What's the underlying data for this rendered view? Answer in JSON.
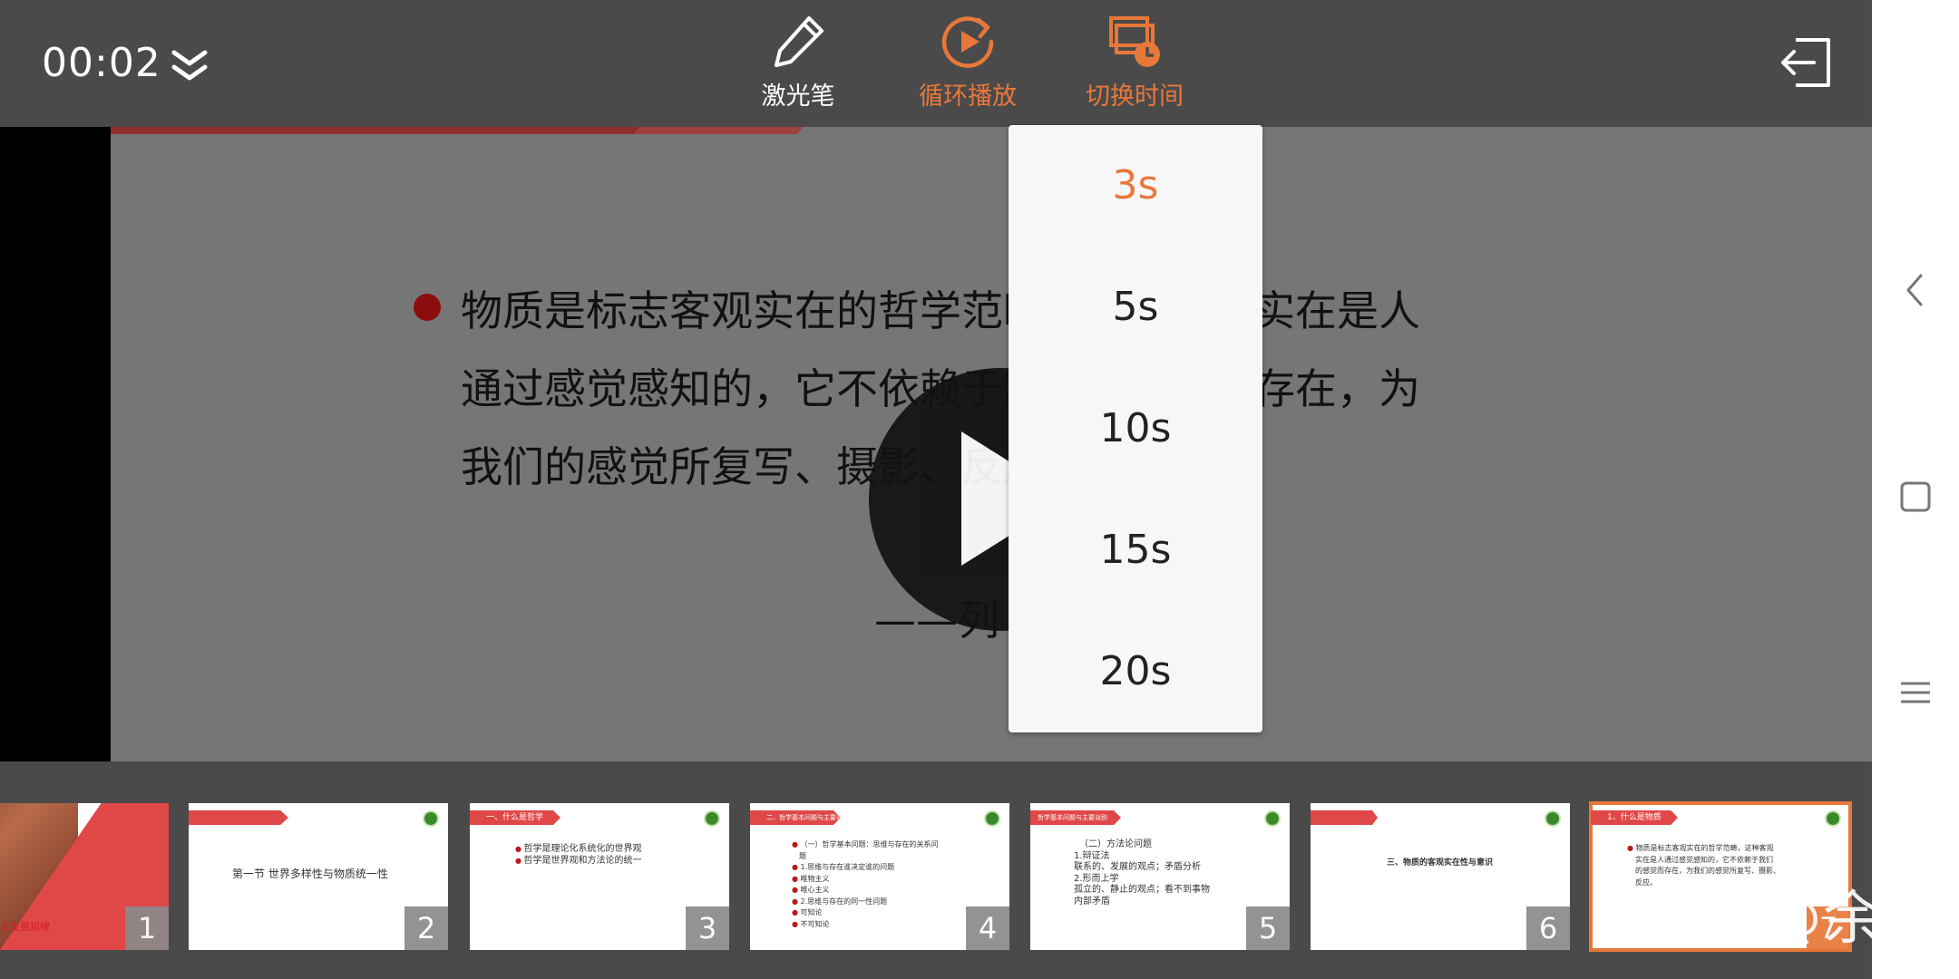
{
  "topbar": {
    "timer": "00:02",
    "tools": [
      {
        "label": "激光笔",
        "icon": "pen-icon",
        "color": "#ffffff"
      },
      {
        "label": "循环播放",
        "icon": "loop-play-icon",
        "color": "#e8783a"
      },
      {
        "label": "切换时间",
        "icon": "switch-time-icon",
        "color": "#e8783a"
      }
    ]
  },
  "slide": {
    "text": "物质是标志客观实在的哲学范畴，这种客观实在是人通过感觉感知的，它不依赖于我们的感觉而存在，为我们的感觉所复写、摄影、反应。",
    "attribution": "——列"
  },
  "dropdown": {
    "options": [
      "3s",
      "5s",
      "10s",
      "15s",
      "20s"
    ],
    "selected": "3s"
  },
  "thumbnails": [
    {
      "num": "1",
      "caption": "及发展规律"
    },
    {
      "num": "2",
      "caption": "第一节 世界多样性与物质统一性"
    },
    {
      "num": "3",
      "ribbon": "一、什么是哲学",
      "lines": [
        "哲学是理论化系统化的世界观",
        "哲学是世界观和方法论的统一"
      ]
    },
    {
      "num": "4",
      "ribbon": "二、哲学基本问题与主要派别",
      "lines": [
        "（一）哲学基本问题：思维与存在的关系问",
        "题",
        "1.思维与存在谁决定谁的问题",
        "唯物主义",
        "唯心主义",
        "2.思维与存在的同一性问题",
        "可知论",
        "不可知论"
      ]
    },
    {
      "num": "5",
      "ribbon": "哲学基本问题与主要派别",
      "lines": [
        "（二）方法论问题",
        "1.辩证法",
        "联系的、发展的观点；矛盾分析",
        "2.形而上学",
        "孤立的、静止的观点；看不到事物",
        "内部矛盾"
      ]
    },
    {
      "num": "6",
      "ribbon": "",
      "lines": [
        "三、物质的客观实在性与意识"
      ]
    },
    {
      "num": "7",
      "ribbon": "1、什么是物质",
      "lines": [
        "物质是标志客观实在的哲学范畴，这种客观",
        "实在是人通过感觉感知的，它不依赖于我们",
        "的感觉而存在，为我们的感觉所复写、摄影、",
        "反应。"
      ]
    }
  ],
  "watermark": "知乎 @余自",
  "colors": {
    "accent": "#e8783a",
    "bar": "#4a4a4a",
    "bullet": "#8b0d0d"
  }
}
